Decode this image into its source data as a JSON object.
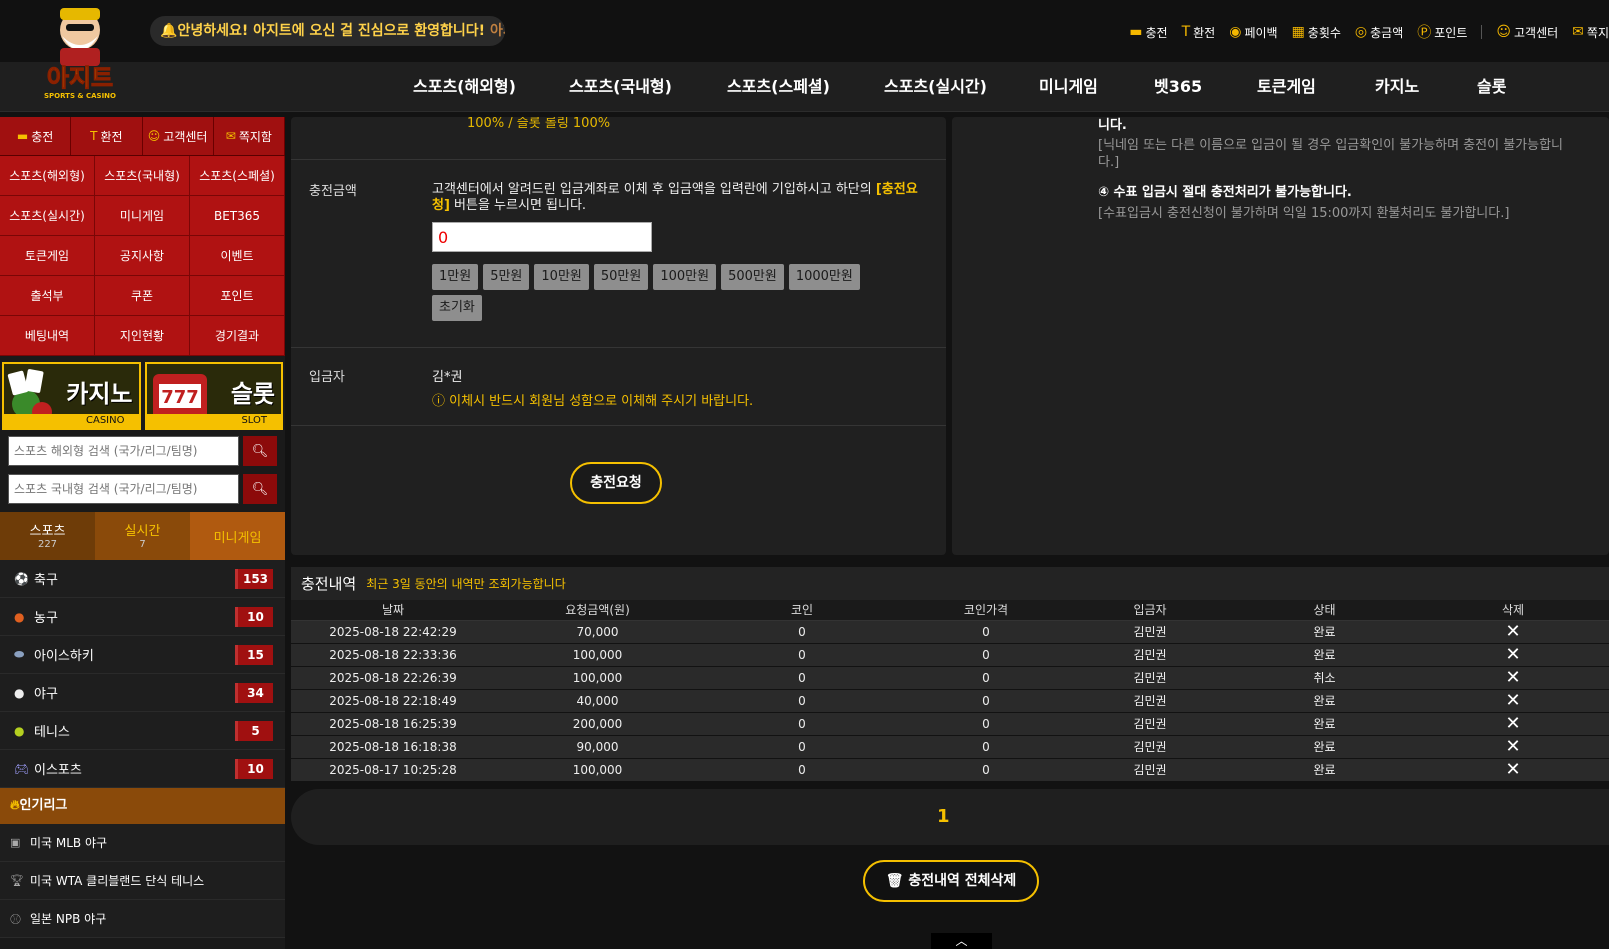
{
  "logo": {
    "main": "아지트",
    "sub": "SPORTS & CASINO"
  },
  "marquee": {
    "part1": "안녕하세요! 아지트에 오신 걸 진심으로 환영합니다!",
    "part2": "아지!"
  },
  "top_links": [
    "충전",
    "환전",
    "페이백",
    "충횟수",
    "충금액",
    "포인트",
    "고객센터",
    "쪽지"
  ],
  "main_nav": [
    "스포츠(해외형)",
    "스포츠(국내형)",
    "스포츠(스페셜)",
    "스포츠(실시간)",
    "미니게임",
    "벳365",
    "토큰게임",
    "카지노",
    "슬롯"
  ],
  "sidebar": {
    "quick": [
      "충전",
      "환전",
      "고객센터",
      "쪽지함"
    ],
    "categories": [
      "스포츠(해외형)",
      "스포츠(국내형)",
      "스포츠(스페셜)",
      "스포츠(실시간)",
      "미니게임",
      "BET365",
      "토큰게임",
      "공지사항",
      "이벤트",
      "출석부",
      "쿠폰",
      "포인트",
      "베팅내역",
      "지인현황",
      "경기결과"
    ],
    "banners": [
      {
        "title": "카지노",
        "sub": "CASINO"
      },
      {
        "title": "슬롯",
        "sub": "SLOT"
      }
    ],
    "search_placeholders": [
      "스포츠 해외형 검색 (국가/리그/팀명)",
      "스포츠 국내형 검색 (국가/리그/팀명)"
    ],
    "tabs": [
      {
        "label": "스포츠",
        "count": "227"
      },
      {
        "label": "실시간",
        "count": "7"
      },
      {
        "label": "미니게임",
        "count": ""
      }
    ],
    "sports": [
      {
        "name": "축구",
        "count": "153",
        "icon": "soccer-ball-icon"
      },
      {
        "name": "농구",
        "count": "10",
        "icon": "basketball-icon"
      },
      {
        "name": "아이스하키",
        "count": "15",
        "icon": "hockey-puck-icon"
      },
      {
        "name": "야구",
        "count": "34",
        "icon": "baseball-icon"
      },
      {
        "name": "테니스",
        "count": "5",
        "icon": "tennis-ball-icon"
      },
      {
        "name": "이스포츠",
        "count": "10",
        "icon": "gamepad-icon"
      }
    ],
    "popular_title": "인기리그",
    "leagues": [
      "미국 MLB 야구",
      "미국 WTA 클리블랜드 단식 테니스",
      "일본 NPB 야구"
    ]
  },
  "panel": {
    "top_text": "100% / 슬롯 롤링 100%",
    "amount_label": "충전금액",
    "amount_desc_1": "고객센터에서 알려드린 입금계좌로 이체 후 입금액을 입력란에 기입하시고 하단의",
    "amount_desc_hl": "[충전요청]",
    "amount_desc_2": "버튼을 누르시면 됩니다.",
    "amount_value": "0",
    "amount_buttons": [
      "1만원",
      "5만원",
      "10만원",
      "50만원",
      "100만원",
      "500만원",
      "1000만원",
      "초기화"
    ],
    "depositor_label": "입금자",
    "depositor_name": "김*권",
    "depositor_warn": "이체시 반드시 회원님 성함으로 이체해 주시기 바랍니다.",
    "submit": "충전요청"
  },
  "info": {
    "line0": "니다.",
    "line1": "[닉네임 또는 다른 이름으로 입금이 될 경우 입금확인이 불가능하며 충전이 불가능합니다.]",
    "line2": "④ 수표 입금시 절대 충전처리가 불가능합니다.",
    "line3": "[수표입금시 충전신청이 불가하며 익일 15:00까지 환불처리도 불가합니다.]"
  },
  "history": {
    "title": "충전내역",
    "subtitle": "최근 3일 동안의 내역만 조회가능합니다",
    "columns": [
      "날짜",
      "요청금액(원)",
      "코인",
      "코인가격",
      "입금자",
      "상태",
      "삭제"
    ],
    "rows": [
      [
        "2025-08-18 22:42:29",
        "70,000",
        "0",
        "0",
        "김민권",
        "완료"
      ],
      [
        "2025-08-18 22:33:36",
        "100,000",
        "0",
        "0",
        "김민권",
        "완료"
      ],
      [
        "2025-08-18 22:26:39",
        "100,000",
        "0",
        "0",
        "김민권",
        "취소"
      ],
      [
        "2025-08-18 22:18:49",
        "40,000",
        "0",
        "0",
        "김민권",
        "완료"
      ],
      [
        "2025-08-18 16:25:39",
        "200,000",
        "0",
        "0",
        "김민권",
        "완료"
      ],
      [
        "2025-08-18 16:18:38",
        "90,000",
        "0",
        "0",
        "김민권",
        "완료"
      ],
      [
        "2025-08-17 10:25:28",
        "100,000",
        "0",
        "0",
        "김민권",
        "완료"
      ]
    ]
  },
  "pager": {
    "page": "1"
  },
  "delete_all": "충전내역 전체삭제",
  "colors": {
    "accent": "#f5c000",
    "red": "#a50f0f",
    "brown": "#8a4a0a"
  }
}
